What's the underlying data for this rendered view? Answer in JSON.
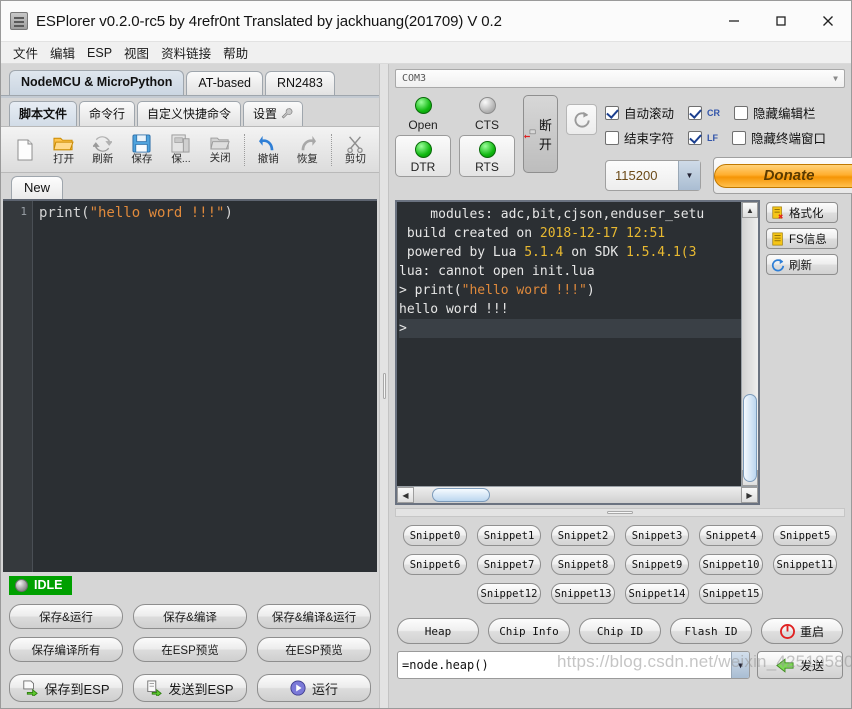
{
  "window": {
    "title": "ESPlorer v0.2.0-rc5 by 4refr0nt Translated by jackhuang(201709) V 0.2",
    "app_icon": "chip-icon",
    "minimize_label": "—",
    "maximize_label": "□",
    "close_label": "✕"
  },
  "menubar": {
    "items": [
      {
        "label": "文件"
      },
      {
        "label": "编辑"
      },
      {
        "label": "ESP"
      },
      {
        "label": "视图"
      },
      {
        "label": "资料链接"
      },
      {
        "label": "帮助"
      }
    ]
  },
  "left": {
    "tabs": [
      {
        "label": "NodeMCU & MicroPython",
        "active": true
      },
      {
        "label": "AT-based",
        "active": false
      },
      {
        "label": "RN2483",
        "active": false
      }
    ],
    "subtabs": [
      {
        "label": "脚本文件",
        "active": true
      },
      {
        "label": "命令行",
        "active": false
      },
      {
        "label": "自定义快捷命令",
        "active": false
      },
      {
        "label": "设置",
        "active": false,
        "icon": "wrench-icon"
      }
    ],
    "toolbar": [
      {
        "label": "",
        "icon": "new-file-icon"
      },
      {
        "label": "打开",
        "icon": "open-folder-icon"
      },
      {
        "label": "刷新",
        "icon": "reload-icon"
      },
      {
        "label": "保存",
        "icon": "save-icon"
      },
      {
        "label": "保...",
        "icon": "save-as-icon"
      },
      {
        "label": "关闭",
        "icon": "close-file-icon"
      },
      {
        "label": "撤销",
        "icon": "undo-icon"
      },
      {
        "label": "恢复",
        "icon": "redo-icon"
      },
      {
        "label": "剪切",
        "icon": "scissors-icon"
      }
    ],
    "file_tab": {
      "label": "New"
    },
    "editor": {
      "line_number": "1",
      "code_prefix": "print(",
      "code_string": "\"hello word !!!\"",
      "code_suffix": ")"
    },
    "status": {
      "label": "IDLE",
      "color": "#00a000"
    },
    "buttons": [
      {
        "label": "保存&运行"
      },
      {
        "label": "保存&编译"
      },
      {
        "label": "保存&编译&运行"
      },
      {
        "label": "保存编译所有"
      },
      {
        "label": "在ESP预览"
      },
      {
        "label": "在ESP预览"
      }
    ],
    "action_buttons": [
      {
        "label": "保存到ESP",
        "icon": "save-to-esp-icon"
      },
      {
        "label": "发送到ESP",
        "icon": "send-to-esp-icon"
      },
      {
        "label": "运行",
        "icon": "play-icon"
      }
    ]
  },
  "right": {
    "port": {
      "value": "COM3",
      "arrow": "▼"
    },
    "leds": [
      {
        "label": "Open",
        "state": "green"
      },
      {
        "label": "CTS",
        "state": "gray"
      }
    ],
    "toggles": [
      {
        "label": "DTR",
        "state": "green"
      },
      {
        "label": "RTS",
        "state": "green"
      }
    ],
    "disconnect": {
      "label": "断开",
      "icon": "disconnect-plug-icon"
    },
    "refresh": {
      "icon": "refresh-icon"
    },
    "checkboxes": [
      {
        "label": "自动滚动",
        "checked": true
      },
      {
        "label": "CR",
        "checked": true,
        "mini": true
      },
      {
        "label": "隐藏编辑栏",
        "checked": false
      },
      {
        "label": "结束字符",
        "checked": false
      },
      {
        "label": "LF",
        "checked": true,
        "mini": true
      },
      {
        "label": "隐藏终端窗口",
        "checked": false
      }
    ],
    "baud": {
      "value": "115200",
      "arrow": "▼"
    },
    "donate": {
      "label": "Donate"
    },
    "terminal": {
      "lines": [
        {
          "parts": [
            {
              "t": "    modules: adc,bit,cjson,enduser_setu",
              "c": "plain"
            }
          ]
        },
        {
          "parts": [
            {
              "t": " build created on ",
              "c": "plain"
            },
            {
              "t": "2018-12-17 12:51",
              "c": "num"
            }
          ]
        },
        {
          "parts": [
            {
              "t": " powered by Lua ",
              "c": "plain"
            },
            {
              "t": "5.1.4",
              "c": "num"
            },
            {
              "t": " on SDK ",
              "c": "plain"
            },
            {
              "t": "1.5.4.1(3",
              "c": "num"
            }
          ]
        },
        {
          "parts": [
            {
              "t": "lua: cannot open init.lua",
              "c": "plain"
            }
          ]
        },
        {
          "parts": [
            {
              "t": "> print(",
              "c": "plain"
            },
            {
              "t": "\"hello word !!!\"",
              "c": "str"
            },
            {
              "t": ")",
              "c": "plain"
            }
          ]
        },
        {
          "parts": [
            {
              "t": "hello word !!!",
              "c": "plain"
            }
          ]
        },
        {
          "parts": [
            {
              "t": ">",
              "c": "plain"
            }
          ]
        }
      ],
      "scroll_up": "▲",
      "scroll_down": "▼",
      "scroll_left": "◀",
      "scroll_right": "▶"
    },
    "side_buttons": [
      {
        "label": "格式化",
        "icon": "format-fs-icon"
      },
      {
        "label": "FS信息",
        "icon": "fs-info-icon"
      },
      {
        "label": "刷新",
        "icon": "refresh-list-icon"
      }
    ],
    "snippets": [
      [
        "Snippet0",
        "Snippet1",
        "Snippet2",
        "Snippet3",
        "Snippet4",
        "Snippet5"
      ],
      [
        "Snippet6",
        "Snippet7",
        "Snippet8",
        "Snippet9",
        "Snippet10",
        "Snippet11"
      ],
      [
        "Snippet12",
        "Snippet13",
        "Snippet14",
        "Snippet15"
      ]
    ],
    "bottom_buttons": [
      {
        "label": "Heap"
      },
      {
        "label": "Chip Info"
      },
      {
        "label": "Chip ID"
      },
      {
        "label": "Flash ID"
      },
      {
        "label": "重启",
        "icon": "power-icon",
        "cjk": true
      }
    ],
    "command": {
      "value": "=node.heap()",
      "arrow": "▼"
    },
    "send": {
      "label": "发送",
      "icon": "send-arrow-icon"
    }
  },
  "watermark": {
    "text": "https://blog.csdn.net/weixin_42510580"
  }
}
